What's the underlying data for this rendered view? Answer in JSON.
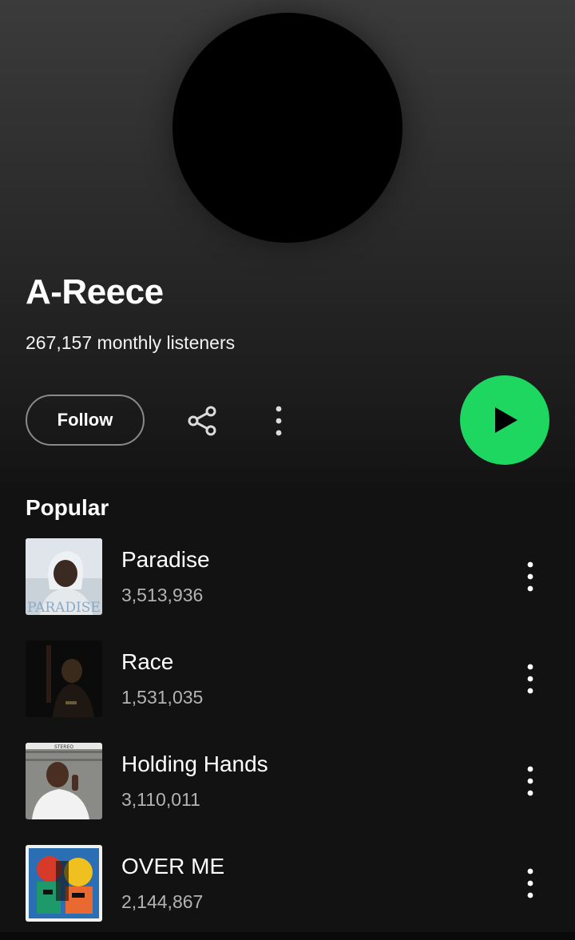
{
  "artist": {
    "name": "A-Reece",
    "monthly_listeners": "267,157 monthly listeners"
  },
  "actions": {
    "follow_label": "Follow",
    "share_icon": "share-icon",
    "more_icon": "more-vertical-icon",
    "play_icon": "play-icon"
  },
  "colors": {
    "accent": "#1ed760",
    "background": "#121212",
    "secondary_text": "#b3b3b3"
  },
  "popular": {
    "title": "Popular",
    "tracks": [
      {
        "title": "Paradise",
        "plays": "3,513,936",
        "cover_text": "PARADISE"
      },
      {
        "title": "Race",
        "plays": "1,531,035"
      },
      {
        "title": "Holding Hands",
        "plays": "3,110,011",
        "cover_text": "STEREO"
      },
      {
        "title": "OVER ME",
        "plays": "2,144,867"
      }
    ]
  }
}
